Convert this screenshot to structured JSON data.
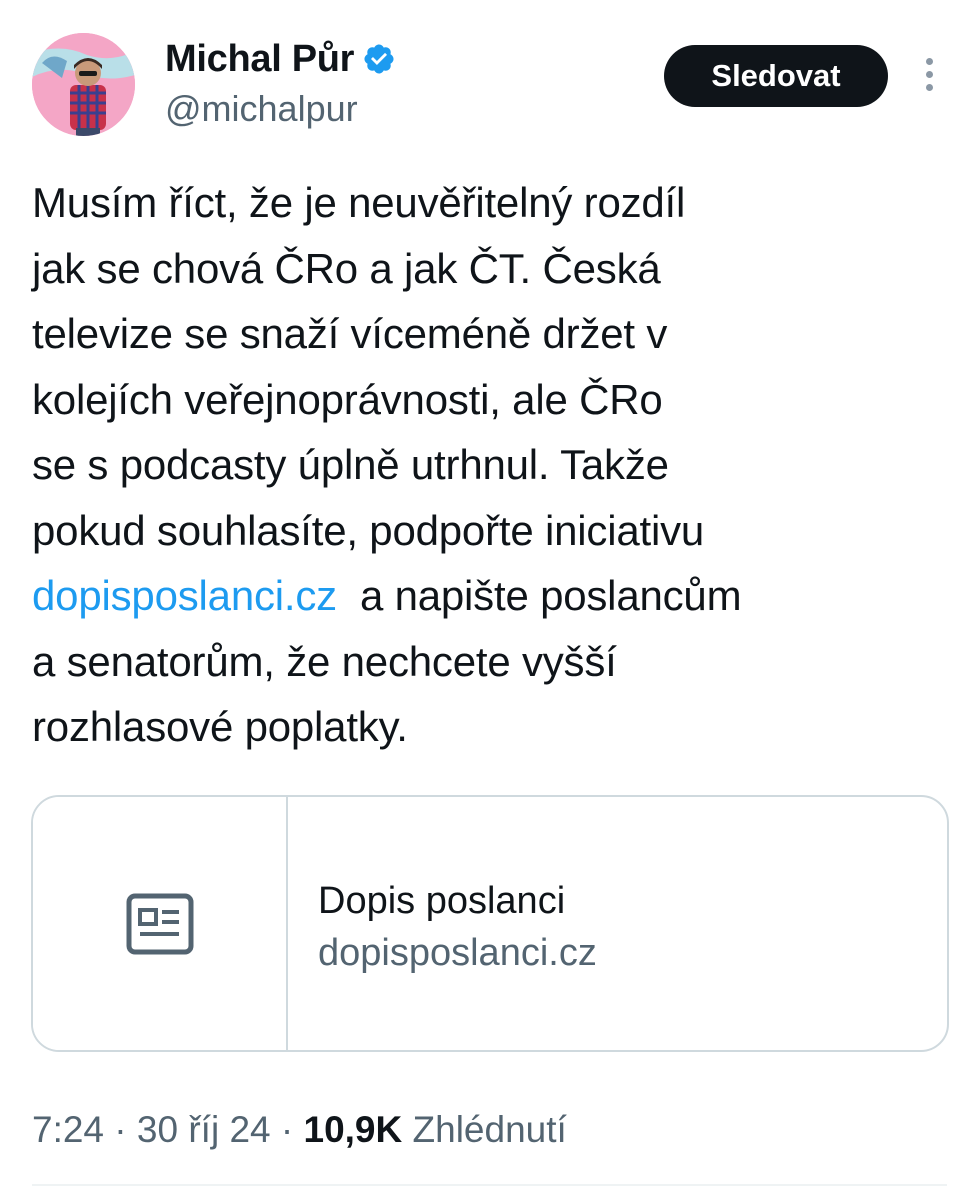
{
  "author": {
    "display_name": "Michal Půr",
    "handle": "@michalpur",
    "verified": true,
    "verified_color": "#1d9bf0"
  },
  "actions": {
    "follow_label": "Sledovat",
    "more_icon": "more-vertical-icon"
  },
  "tweet": {
    "lines": [
      "Musím říct, že je neuvěřitelný rozdíl",
      "jak se chová ČRo a jak ČT. Česká",
      "televize se snaží víceméně držet v",
      "kolejích veřejnoprávnosti, ale ČRo",
      "se s podcasty úplně utrhnul. Takže",
      "pokud souhlasíte, podpořte iniciativu"
    ],
    "link_text": "dopisposlanci.cz",
    "after_link": " a napište poslancům",
    "tail_lines": [
      "a senatorům, že nechcete vyšší",
      "rozhlasové poplatky."
    ]
  },
  "card": {
    "icon": "article-icon",
    "title": "Dopis poslanci",
    "domain": "dopisposlanci.cz"
  },
  "meta": {
    "time": "7:24",
    "sep1": " · ",
    "date": "30 říj 24",
    "sep2": " · ",
    "views_count": "10,9K",
    "views_label": " Zhlédnutí"
  },
  "colors": {
    "text": "#0f1419",
    "secondary": "#536471",
    "link": "#1d9bf0",
    "border": "#cfd9de"
  }
}
